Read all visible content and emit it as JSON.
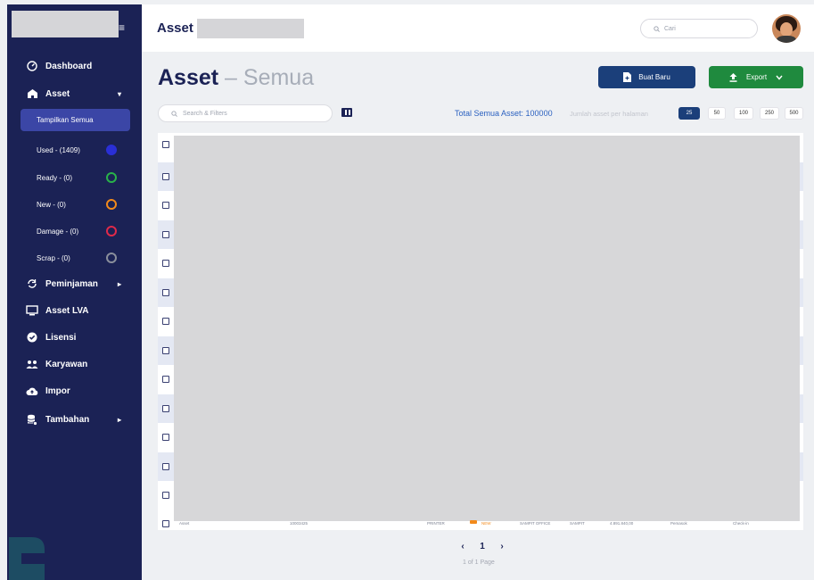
{
  "sidebar": {
    "menu_icon": "≡",
    "items": [
      {
        "label": "Dashboard",
        "icon": "dashboard-icon"
      },
      {
        "label": "Asset",
        "icon": "home-icon",
        "chevron": "▾"
      },
      {
        "label": "Peminjaman",
        "icon": "sync-icon",
        "chevron": "▸"
      },
      {
        "label": "Asset LVA",
        "icon": "monitor-icon"
      },
      {
        "label": "Lisensi",
        "icon": "check-badge-icon"
      },
      {
        "label": "Karyawan",
        "icon": "people-icon"
      },
      {
        "label": "Impor",
        "icon": "cloud-upload-icon"
      },
      {
        "label": "Tambahan",
        "icon": "database-icon",
        "chevron": "▸"
      }
    ],
    "asset_sub": {
      "active": "Tampilkan Semua",
      "items": [
        {
          "label": "Used - (1409)",
          "color": "#2a2fd6"
        },
        {
          "label": "Ready - (0)",
          "color": "#29b24a"
        },
        {
          "label": "New - (0)",
          "color": "#f28a1b"
        },
        {
          "label": "Damage - (0)",
          "color": "#e02a4a"
        },
        {
          "label": "Scrap - (0)",
          "color": "#8a8f9c"
        }
      ]
    }
  },
  "topbar": {
    "title": "Asset",
    "search_placeholder": "Cari"
  },
  "page": {
    "title": "Asset",
    "separator": "–",
    "subtitle": "Semua",
    "new_button": "Buat Baru",
    "export_button": "Export",
    "search_placeholder": "Search & Filters",
    "total_label": "Total Semua Asset: 100000",
    "per_page_label": "Jumlah asset per halaman",
    "per_page_options": [
      "25",
      "50",
      "100",
      "250",
      "500"
    ],
    "per_page_active": "25"
  },
  "table": {
    "last_row": {
      "type": "Asset",
      "code": "10003425",
      "category": "PRINTER",
      "status": "NEW",
      "location": "SAMPIT OFFICE",
      "site": "SAMPIT",
      "price": "4.891.840,00",
      "owner": "Pemasok",
      "action": "Check-in"
    }
  },
  "pagination": {
    "prev": "‹",
    "current": "1",
    "next": "›",
    "info": "1 of 1 Page"
  },
  "colors": {
    "sidebar": "#1b2255",
    "primary": "#1b3f7a",
    "export": "#1f8a3e",
    "accent_text": "#2b61c0"
  }
}
